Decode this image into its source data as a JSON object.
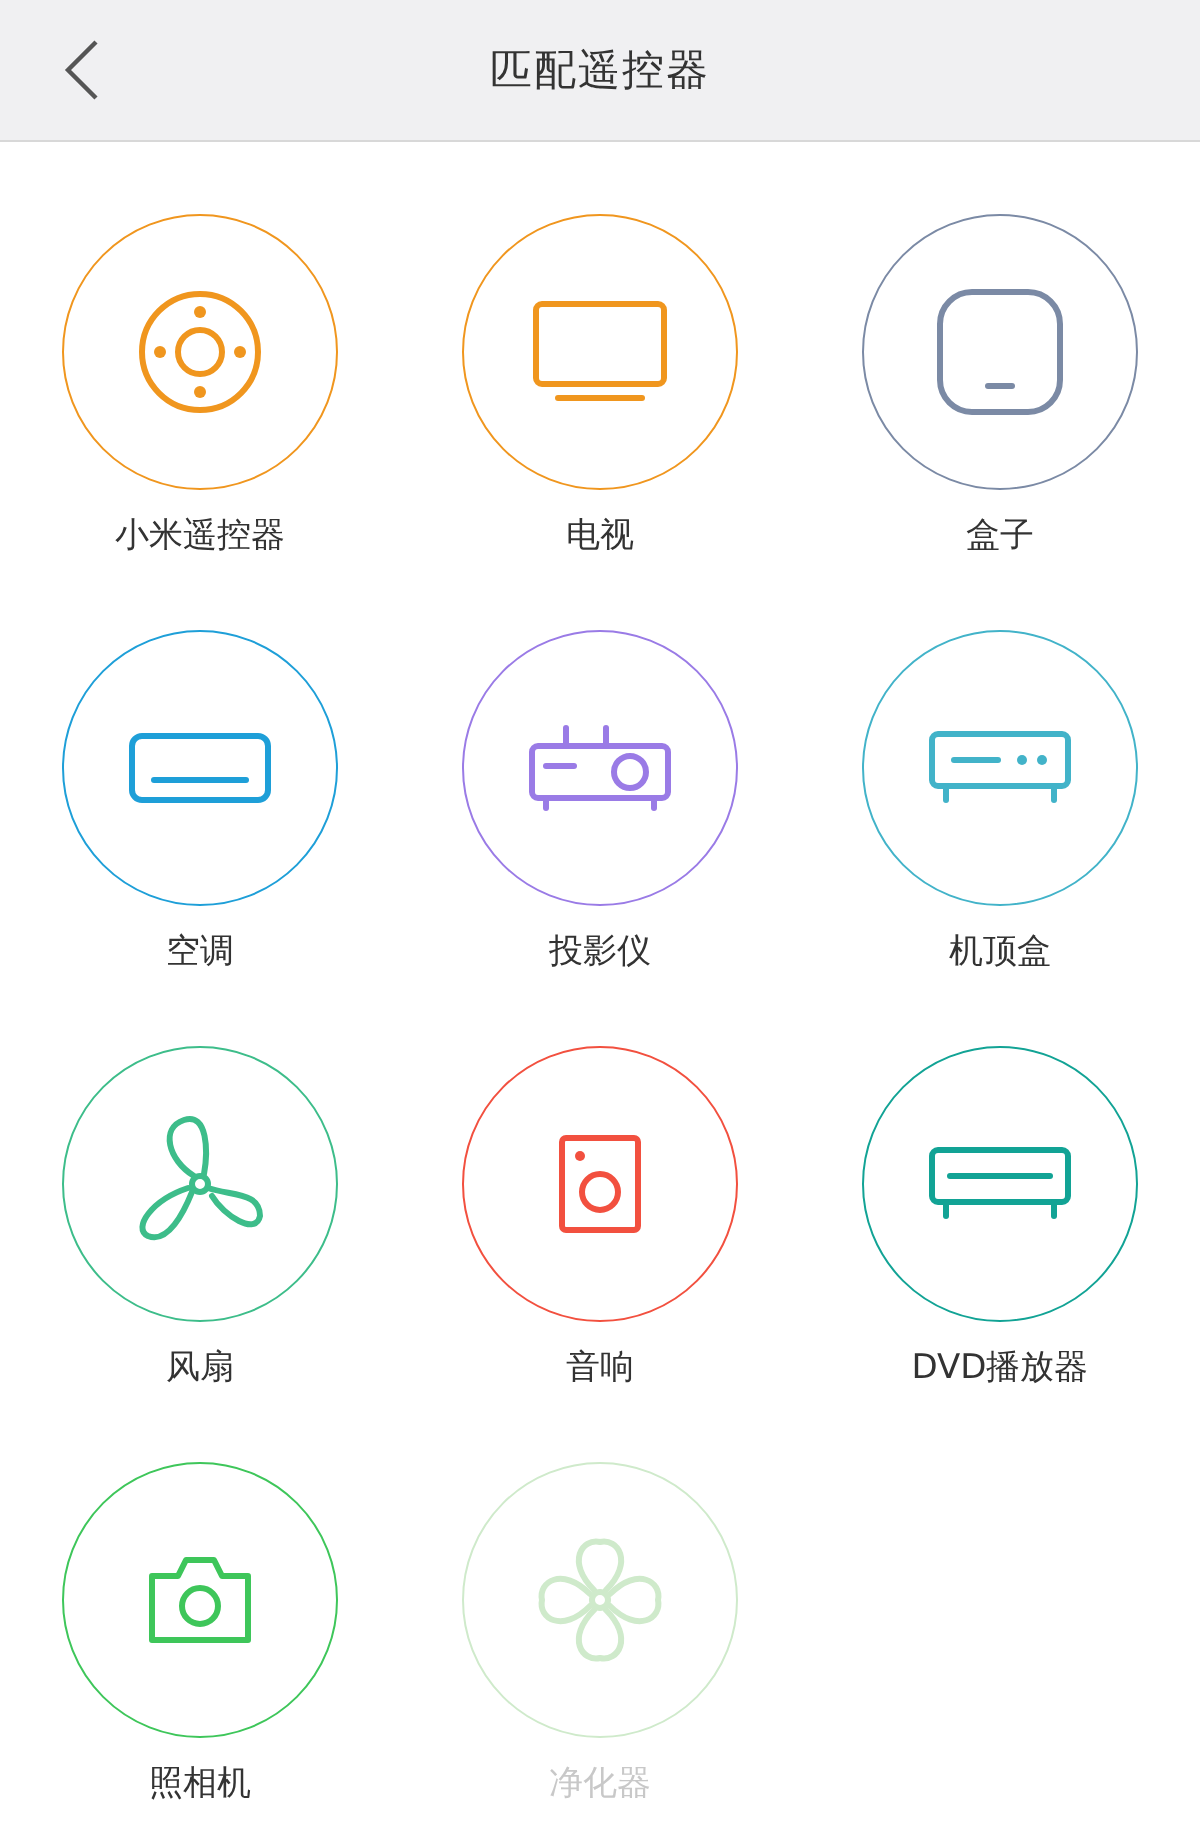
{
  "header": {
    "title": "匹配遥控器"
  },
  "devices": [
    {
      "label": "小米遥控器",
      "kind": "remote",
      "color": "#f0961e",
      "disabled": false
    },
    {
      "label": "电视",
      "kind": "tv",
      "color": "#f0961e",
      "disabled": false
    },
    {
      "label": "盒子",
      "kind": "box",
      "color": "#7b8aa5",
      "disabled": false
    },
    {
      "label": "空调",
      "kind": "ac",
      "color": "#1e9fd8",
      "disabled": false
    },
    {
      "label": "投影仪",
      "kind": "projector",
      "color": "#9a7be6",
      "disabled": false
    },
    {
      "label": "机顶盒",
      "kind": "settop",
      "color": "#42b3c9",
      "disabled": false
    },
    {
      "label": "风扇",
      "kind": "fan",
      "color": "#3dbd8a",
      "disabled": false
    },
    {
      "label": "音响",
      "kind": "speaker",
      "color": "#f2503f",
      "disabled": false
    },
    {
      "label": "DVD播放器",
      "kind": "dvd",
      "color": "#12a395",
      "disabled": false
    },
    {
      "label": "照相机",
      "kind": "camera",
      "color": "#3ec65a",
      "disabled": false
    },
    {
      "label": "净化器",
      "kind": "purifier",
      "color": "#cfeacb",
      "disabled": true
    }
  ]
}
